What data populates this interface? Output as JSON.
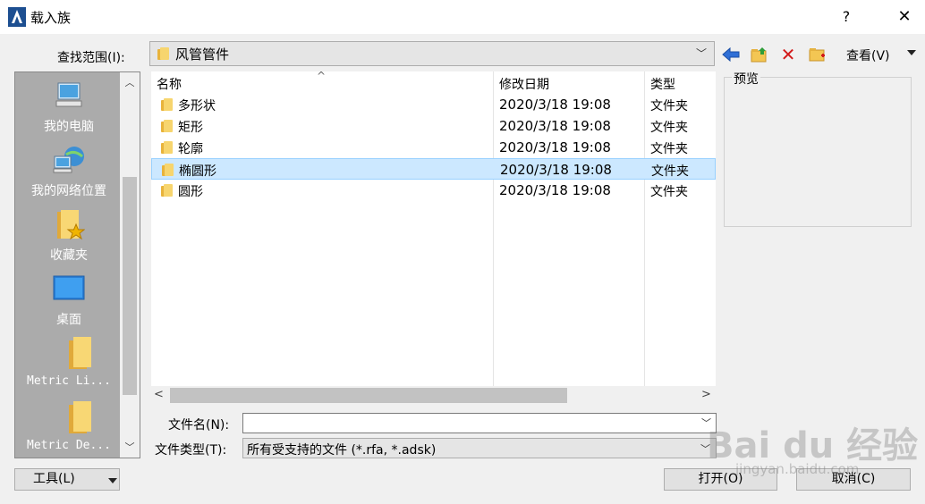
{
  "window": {
    "title": "载入族",
    "help_label": "?",
    "close_label": "✕"
  },
  "lookup": {
    "label": "查找范围(I):",
    "value": "风管管件"
  },
  "toolbar": {
    "view_label": "查看(V)"
  },
  "places": [
    {
      "label": "我的电脑",
      "icon": "computer-icon"
    },
    {
      "label": "我的网络位置",
      "icon": "network-icon"
    },
    {
      "label": "收藏夹",
      "icon": "favorites-icon"
    },
    {
      "label": "桌面",
      "icon": "desktop-icon"
    },
    {
      "label": "Metric Li...",
      "icon": "folder-icon"
    },
    {
      "label": "Metric De...",
      "icon": "folder-icon"
    }
  ],
  "filelist": {
    "columns": {
      "name": "名称",
      "modified": "修改日期",
      "type": "类型"
    },
    "rows": [
      {
        "name": "多形状",
        "modified": "2020/3/18 19:08",
        "type": "文件夹"
      },
      {
        "name": "矩形",
        "modified": "2020/3/18 19:08",
        "type": "文件夹"
      },
      {
        "name": "轮廓",
        "modified": "2020/3/18 19:08",
        "type": "文件夹"
      },
      {
        "name": "椭圆形",
        "modified": "2020/3/18 19:08",
        "type": "文件夹",
        "selected": true
      },
      {
        "name": "圆形",
        "modified": "2020/3/18 19:08",
        "type": "文件夹"
      }
    ]
  },
  "preview": {
    "label": "预览"
  },
  "filename": {
    "label": "文件名(N):",
    "value": ""
  },
  "filetype": {
    "label": "文件类型(T):",
    "value": "所有受支持的文件 (*.rfa, *.adsk)"
  },
  "buttons": {
    "tools": "工具(L)",
    "open": "打开(O)",
    "cancel": "取消(C)"
  },
  "watermark": {
    "main": "Bai du 经验",
    "sub": "jingyan.baidu.com"
  },
  "colors": {
    "selection": "#cce8ff",
    "sidebar": "#ababab",
    "delete": "#d21a1a"
  }
}
